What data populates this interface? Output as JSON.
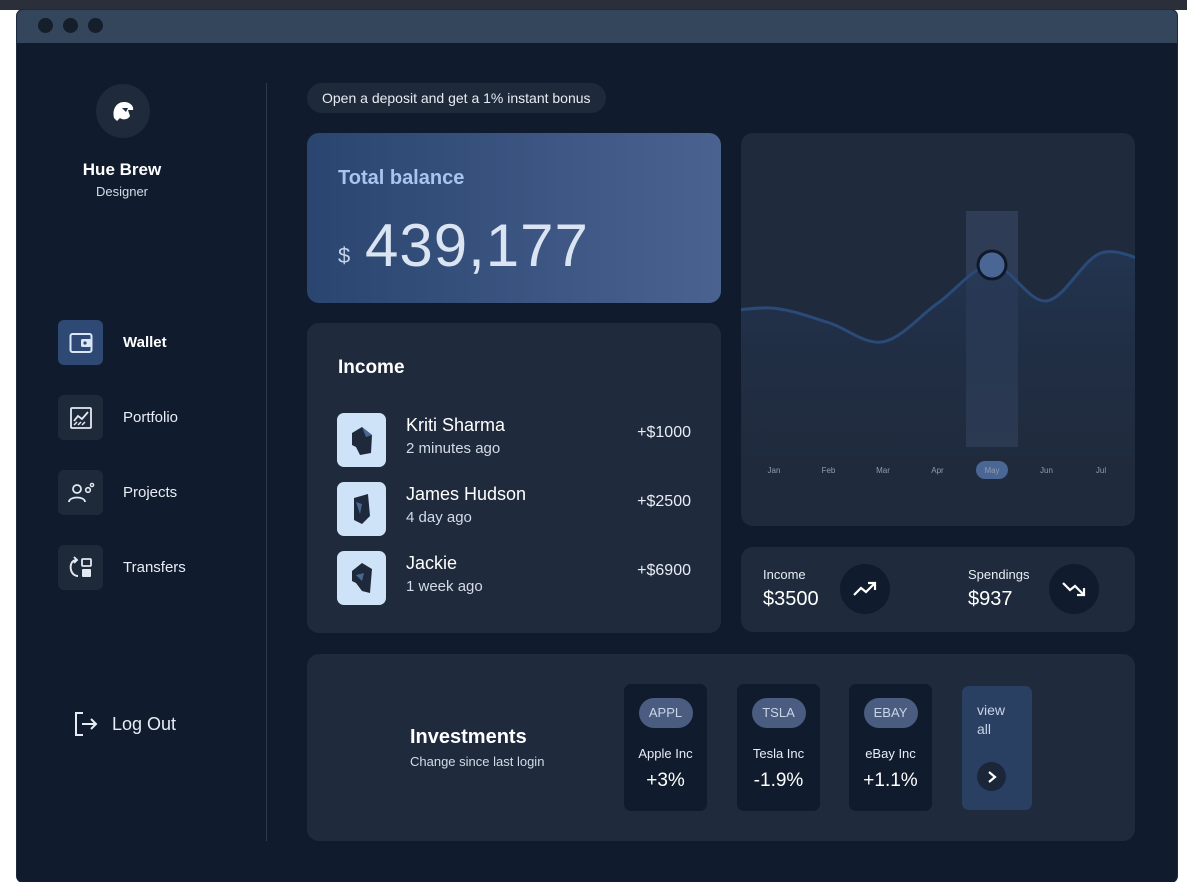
{
  "user": {
    "name": "Hue Brew",
    "role": "Designer"
  },
  "nav": {
    "items": [
      {
        "label": "Wallet",
        "icon": "wallet-icon",
        "active": true
      },
      {
        "label": "Portfolio",
        "icon": "chart-icon",
        "active": false
      },
      {
        "label": "Projects",
        "icon": "team-settings-icon",
        "active": false
      },
      {
        "label": "Transfers",
        "icon": "transfer-icon",
        "active": false
      }
    ],
    "logout": "Log Out"
  },
  "promo": "Open a deposit and get a 1% instant bonus",
  "balance": {
    "title": "Total balance",
    "currency": "$",
    "amount": "439,177"
  },
  "income": {
    "title": "Income",
    "rows": [
      {
        "name": "Kriti Sharma",
        "time": "2 minutes ago",
        "amount": "+$1000"
      },
      {
        "name": "James Hudson",
        "time": "4 day ago",
        "amount": "+$2500"
      },
      {
        "name": "Jackie",
        "time": "1 week ago",
        "amount": "+$6900"
      }
    ]
  },
  "chart_data": {
    "type": "line",
    "categories": [
      "Jan",
      "Feb",
      "Mar",
      "Apr",
      "May",
      "Jun",
      "Jul"
    ],
    "values": [
      52,
      46,
      38,
      54,
      70,
      55,
      75
    ],
    "highlight": "May",
    "ylim": [
      0,
      100
    ],
    "grid": false,
    "colors": {
      "line": "#2a4a78",
      "highlight_band": "#2e3d55",
      "marker": "#4a6694"
    }
  },
  "stats": {
    "income": {
      "label": "Income",
      "value": "$3500",
      "icon": "trend-up-icon"
    },
    "spendings": {
      "label": "Spendings",
      "value": "$937",
      "icon": "trend-down-icon"
    }
  },
  "investments": {
    "title": "Investments",
    "subtitle": "Change since last login",
    "stocks": [
      {
        "ticker": "APPL",
        "name": "Apple Inc",
        "change": "+3%"
      },
      {
        "ticker": "TSLA",
        "name": "Tesla Inc",
        "change": "-1.9%"
      },
      {
        "ticker": "EBAY",
        "name": "eBay Inc",
        "change": "+1.1%"
      }
    ],
    "view_all": "view all"
  }
}
